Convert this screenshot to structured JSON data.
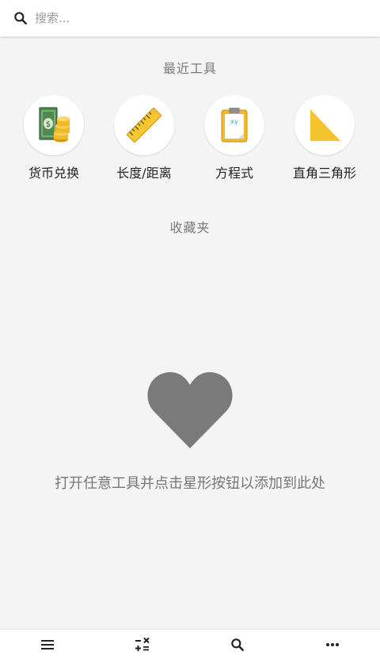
{
  "search": {
    "placeholder": "搜索..."
  },
  "recent": {
    "title": "最近工具",
    "tools": [
      {
        "label": "货币兑换",
        "icon": "currency-exchange-icon"
      },
      {
        "label": "长度/距离",
        "icon": "ruler-icon"
      },
      {
        "label": "方程式",
        "icon": "equation-clipboard-icon"
      },
      {
        "label": "直角三角形",
        "icon": "right-triangle-icon"
      }
    ]
  },
  "favorites": {
    "title": "收藏夹",
    "empty_icon": "heart-icon",
    "empty_message": "打开任意工具并点击星形按钮以添加到此处"
  },
  "bottom_nav": {
    "items": [
      {
        "icon": "menu-icon"
      },
      {
        "icon": "calculator-operators-icon"
      },
      {
        "icon": "search-icon"
      },
      {
        "icon": "more-icon"
      }
    ]
  },
  "colors": {
    "background": "#f4f4f4",
    "heart": "#7a7a7a",
    "ruler": "#f7c531",
    "triangle": "#f5c32e",
    "money": "#4f8a4e",
    "coin": "#f2b928"
  }
}
